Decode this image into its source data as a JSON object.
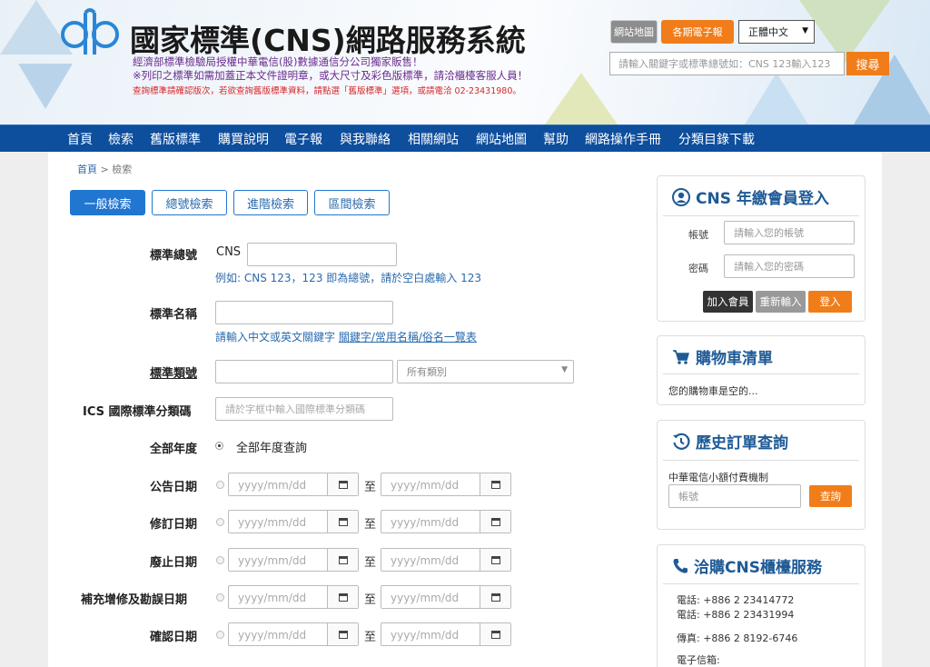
{
  "header": {
    "site_title": "國家標準(CNS)網路服務系統",
    "notice_line1": "經濟部標準檢驗局授權中華電信(股)數據通信分公司獨家販售！",
    "notice_line2": "※列印之標準如需加蓋正本文件證明章，或大尺寸及彩色版標準，請洽櫃檯客服人員！",
    "notice_line3": "查詢標準請確認版次，若欲查詢舊版標準資料，請點選「舊版標準」選項，或請電洽 02-23431980。",
    "sitemap_btn": "網站地圖",
    "epaper_btn": "各期電子報",
    "lang_value": "正體中文",
    "search_placeholder": "請輸入關鍵字或標準總號如：CNS 123輸入123",
    "search_btn": "搜尋"
  },
  "nav": [
    "首頁",
    "檢索",
    "舊版標準",
    "購買說明",
    "電子報",
    "與我聯絡",
    "相關網站",
    "網站地圖",
    "幫助",
    "網路操作手冊",
    "分類目錄下載"
  ],
  "breadcrumb": {
    "home": "首頁",
    "sep": ">",
    "current": "檢索"
  },
  "tabs": [
    "一般檢索",
    "總號檢索",
    "進階檢索",
    "區間檢索"
  ],
  "form": {
    "std_no_label": "標準總號",
    "std_no_prefix": "CNS",
    "std_no_hint": "例如: CNS 123，123 即為總號，請於空白處輸入 123",
    "std_name_label": "標準名稱",
    "std_name_hint": "請輸入中文或英文關鍵字",
    "std_name_link": "關鍵字/常用名稱/俗名一覽表",
    "std_class_label": "標準類號",
    "std_class_select": "所有類別",
    "ics_label": "ICS 國際標準分類碼",
    "ics_placeholder": "請於字框中輸入國際標準分類碼",
    "year_label": "全部年度",
    "year_option": "全部年度查詢",
    "date_placeholder": "yyyy/mm/dd",
    "to_text": "至",
    "date_rows": [
      "公告日期",
      "修訂日期",
      "廢止日期",
      "補充增修及勘誤日期",
      "確認日期"
    ]
  },
  "sidebar": {
    "login": {
      "title": "CNS 年繳會員登入",
      "account_label": "帳號",
      "account_placeholder": "請輸入您的帳號",
      "password_label": "密碼",
      "password_placeholder": "請輸入您的密碼",
      "join_btn": "加入會員",
      "reset_btn": "重新輸入",
      "login_btn": "登入"
    },
    "cart": {
      "title": "購物車清單",
      "empty_text": "您的購物車是空的..."
    },
    "history": {
      "title": "歷史訂單查詢",
      "subtitle": "中華電信小額付費機制",
      "account_placeholder": "帳號",
      "query_btn": "查詢"
    },
    "service": {
      "title": "洽購CNS櫃檯服務",
      "phone1": "電話: +886 2 23414772",
      "phone2": "電話: +886 2 23431994",
      "fax": "傳真: +886 2 8192-6746",
      "email_label": "電子信箱:"
    }
  },
  "colors": {
    "nav_bg": "#0d4e9d",
    "accent_orange": "#f07d1a",
    "tab_blue": "#2176d2"
  }
}
